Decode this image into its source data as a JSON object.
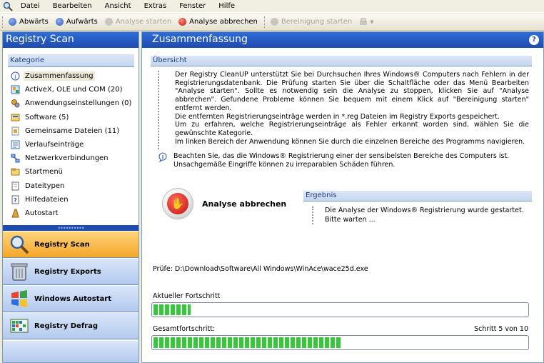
{
  "menu": {
    "items": [
      "Datei",
      "Bearbeiten",
      "Ansicht",
      "Extras",
      "Fenster",
      "Hilfe"
    ]
  },
  "toolbar": {
    "back": "Abwärts",
    "forward": "Aufwärts",
    "start": "Analyse starten",
    "abort": "Analyse abbrechen",
    "cleanup": "Bereinigung starten"
  },
  "sidebar": {
    "title": "Registry Scan",
    "category_header": "Kategorie",
    "items": [
      {
        "label": "Zusammenfassung",
        "icon": "info-icon"
      },
      {
        "label": "ActiveX, OLE und COM (20)",
        "icon": "component-icon"
      },
      {
        "label": "Anwendungseinstellungen (0)",
        "icon": "gears-icon"
      },
      {
        "label": "Software (5)",
        "icon": "software-icon"
      },
      {
        "label": "Gemeinsame Dateien (11)",
        "icon": "shared-files-icon"
      },
      {
        "label": "Verlaufseinträge",
        "icon": "history-icon"
      },
      {
        "label": "Netzwerkverbindungen",
        "icon": "network-icon"
      },
      {
        "label": "Startmenü",
        "icon": "start-menu-icon"
      },
      {
        "label": "Dateitypen",
        "icon": "file-types-icon"
      },
      {
        "label": "Hilfedateien",
        "icon": "help-files-icon"
      },
      {
        "label": "Autostart",
        "icon": "autostart-icon"
      }
    ],
    "nav": [
      {
        "label": "Registry Scan",
        "icon": "magnifier-icon",
        "active": true
      },
      {
        "label": "Registry Exports",
        "icon": "recycle-bin-icon",
        "active": false
      },
      {
        "label": "Windows Autostart",
        "icon": "windows-flag-icon",
        "active": false
      },
      {
        "label": "Registry Defrag",
        "icon": "defrag-icon",
        "active": false
      }
    ]
  },
  "main": {
    "title": "Zusammenfassung",
    "overview_header": "Übersicht",
    "intro_lines": [
      "Der Registry CleanUP unterstützt Sie bei Durchsuchen Ihres Windows® Computers nach Fehlern in der Registrierungsdatenbank. Die Prüfung starten Sie über die Schaltfläche oder das Menü Bearbeiten \"Analyse starten\". Sollte es notwendig sein die Analyse zu stoppen, klicken Sie auf \"Analyse abbrechen\". Gefundene Probleme können Sie bequem mit einem Klick auf \"Bereinigung starten\" entfernt werden.",
      "Die entfernten Registrierungseinträge werden in *.reg Dateien im Registry Exports gespeichert.",
      "Um zu erfahren, welche Registrierungseinträge als Fehler erkannt worden sind, wählen Sie die gewünschte Kategorie.",
      "Im linken Bereich der Anwendung können Sie durch die einzelnen Bereiche des Programms navigieren."
    ],
    "warning": "Beachten Sie, das die Windows® Registrierung einer der sensibelsten Bereiche des Computers ist. Unsachgemäße Eingriffe können zu irreparablen Schäden führen.",
    "big_button": "Analyse abbrechen",
    "result_header": "Ergebnis",
    "result_text": "Die Analyse der Windows® Registrierung wurde gestartet. Bitte warten ...",
    "path": "Prüfe: D:\\Download\\Software\\All Windows\\WinAce\\wace25d.exe",
    "current_label": "Aktueller Fortschritt",
    "current_progress": 0.1,
    "total_label": "Gesamtfortschritt:",
    "total_progress": 0.5,
    "step_text": "Schritt 5 von 10"
  },
  "colors": {
    "header_blue": "#1e4bb0",
    "progress_green": "#35c93a",
    "active_nav": "#f5a72a"
  }
}
